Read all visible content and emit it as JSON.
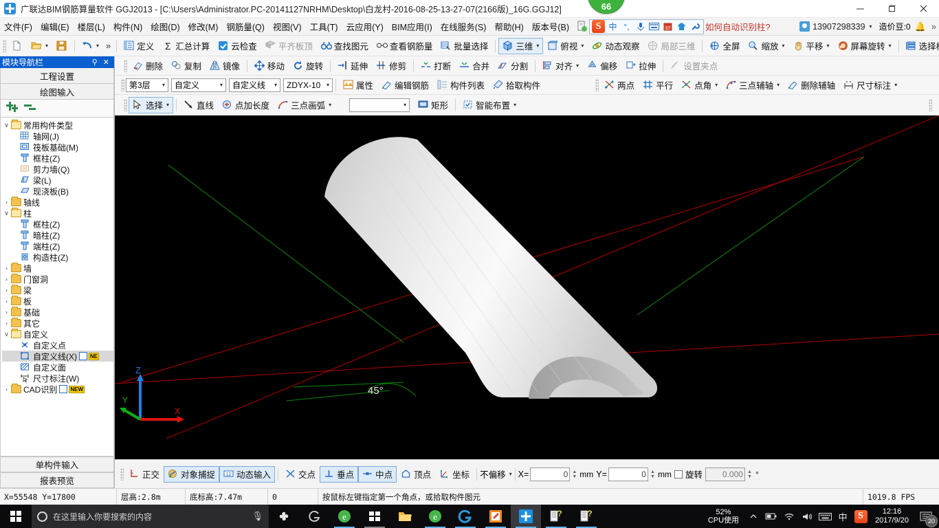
{
  "window": {
    "title": "广联达BIM钢筋算量软件 GGJ2013 - [C:\\Users\\Administrator.PC-20141127NRHM\\Desktop\\白龙村-2016-08-25-13-27-07(2166版)_16G.GGJ12]",
    "badge_value": "66",
    "minimize": "–",
    "maximize": "❐",
    "close": "✕"
  },
  "menubar": {
    "items": [
      {
        "label": "文件(F)"
      },
      {
        "label": "编辑(E)"
      },
      {
        "label": "楼层(L)"
      },
      {
        "label": "构件(N)"
      },
      {
        "label": "绘图(D)"
      },
      {
        "label": "修改(M)"
      },
      {
        "label": "钢筋量(Q)"
      },
      {
        "label": "视图(V)"
      },
      {
        "label": "工具(T)"
      },
      {
        "label": "云应用(Y)"
      },
      {
        "label": "BIM应用(I)"
      },
      {
        "label": "在线服务(S)"
      },
      {
        "label": "帮助(H)"
      },
      {
        "label": "版本号(B)"
      }
    ],
    "ime": {
      "lang": "中",
      "sogou": "S"
    },
    "promo_link": "如何自动识别柱?",
    "account_phone": "13907298339",
    "coins_label": "造价豆:0",
    "overflow": "»"
  },
  "toolbar_row1": {
    "items": [
      {
        "name": "new",
        "label": "",
        "icon": "page-icon"
      },
      {
        "name": "open",
        "label": "",
        "icon": "folder-open-icon",
        "caret": true
      },
      {
        "name": "save",
        "label": "",
        "icon": "save-icon"
      },
      {
        "name": "undo",
        "label": "",
        "icon": "undo-icon",
        "caret": true
      }
    ],
    "overflow": "»",
    "group2": [
      {
        "name": "define",
        "label": "定义",
        "icon": "define-icon",
        "dim": false
      },
      {
        "name": "summary-calc",
        "label": "汇总计算",
        "icon": "sigma-icon",
        "dim": false
      },
      {
        "name": "cloud-check",
        "label": "云检查",
        "icon": "cloud-check-icon",
        "dim": false
      },
      {
        "name": "align-slab-top",
        "label": "平齐板顶",
        "icon": "align-slab-icon",
        "dim": true
      },
      {
        "name": "find-element",
        "label": "查找图元",
        "icon": "binoculars-icon",
        "dim": false
      },
      {
        "name": "view-rebar-qty",
        "label": "查看钢筋量",
        "icon": "glasses-icon",
        "dim": false
      },
      {
        "name": "batch-select",
        "label": "批量选择",
        "icon": "batch-select-icon",
        "dim": false
      }
    ],
    "group3": [
      {
        "name": "three-d",
        "label": "三维",
        "icon": "cube-icon",
        "caret": true,
        "active": true
      },
      {
        "name": "top-view",
        "label": "俯视",
        "icon": "topview-icon",
        "caret": true
      },
      {
        "name": "dynamic-observe",
        "label": "动态观察",
        "icon": "orbit-icon"
      },
      {
        "name": "local-three-d",
        "label": "局部三维",
        "icon": "local3d-icon",
        "dim": true
      },
      {
        "name": "fullscreen",
        "label": "全屏",
        "icon": "fullscreen-icon"
      },
      {
        "name": "zoom",
        "label": "缩放",
        "icon": "zoom-icon",
        "caret": true
      },
      {
        "name": "pan",
        "label": "平移",
        "icon": "pan-icon",
        "caret": true
      },
      {
        "name": "screen-rotate",
        "label": "屏幕旋转",
        "icon": "screen-rotate-icon",
        "caret": true
      },
      {
        "name": "select-floor",
        "label": "选择楼层",
        "icon": "floor-icon"
      }
    ],
    "overflow2": "»"
  },
  "toolbar_row2": {
    "items": [
      {
        "name": "delete",
        "label": "删除",
        "icon": "eraser-icon"
      },
      {
        "name": "copy",
        "label": "复制",
        "icon": "copy-icon"
      },
      {
        "name": "mirror",
        "label": "镜像",
        "icon": "mirror-icon"
      },
      {
        "name": "move",
        "label": "移动",
        "icon": "move-icon"
      },
      {
        "name": "rotate",
        "label": "旋转",
        "icon": "rotate-icon"
      },
      {
        "name": "extend",
        "label": "延伸",
        "icon": "extend-icon"
      },
      {
        "name": "trim",
        "label": "修剪",
        "icon": "trim-icon"
      },
      {
        "name": "break",
        "label": "打断",
        "icon": "break-icon"
      },
      {
        "name": "merge",
        "label": "合并",
        "icon": "merge-icon"
      },
      {
        "name": "split",
        "label": "分割",
        "icon": "split-icon"
      },
      {
        "name": "align",
        "label": "对齐",
        "icon": "align-icon",
        "caret": true
      },
      {
        "name": "offset",
        "label": "偏移",
        "icon": "offset-icon"
      },
      {
        "name": "stretch",
        "label": "拉伸",
        "icon": "stretch-icon"
      },
      {
        "name": "set-grip",
        "label": "设置夹点",
        "icon": "grip-icon",
        "dim": true
      }
    ]
  },
  "toolbar_row3": {
    "selects": [
      {
        "name": "floor-select",
        "value": "第3层"
      },
      {
        "name": "component-type-select",
        "value": "自定义"
      },
      {
        "name": "component-subtype-select",
        "value": "自定义线"
      },
      {
        "name": "component-name-select",
        "value": "ZDYX-10"
      }
    ],
    "buttons": [
      {
        "name": "properties",
        "label": "属性",
        "icon": "properties-icon"
      },
      {
        "name": "edit-rebar",
        "label": "编辑钢筋",
        "icon": "edit-rebar-icon"
      },
      {
        "name": "component-list",
        "label": "构件列表",
        "icon": "list-icon"
      },
      {
        "name": "pick-component",
        "label": "拾取构件",
        "icon": "pipette-icon"
      }
    ],
    "aux_axis": [
      {
        "name": "two-point",
        "label": "两点",
        "icon": "two-point-icon"
      },
      {
        "name": "parallel",
        "label": "平行",
        "icon": "parallel-icon"
      },
      {
        "name": "point-angle",
        "label": "点角",
        "icon": "point-angle-icon",
        "caret": true
      },
      {
        "name": "three-point-aux-axis",
        "label": "三点辅轴",
        "icon": "three-point-axis-icon",
        "caret": true
      },
      {
        "name": "delete-aux-axis",
        "label": "删除辅轴",
        "icon": "delete-axis-icon"
      },
      {
        "name": "dimension",
        "label": "尺寸标注",
        "icon": "dimension-icon",
        "caret": true
      }
    ]
  },
  "toolbar_row4": {
    "items": [
      {
        "name": "select-tool",
        "label": "选择",
        "icon": "cursor-icon",
        "caret": true,
        "active": true
      },
      {
        "name": "line-tool",
        "label": "直线",
        "icon": "line-icon"
      },
      {
        "name": "point-plus-length",
        "label": "点加长度",
        "icon": "point-length-icon"
      },
      {
        "name": "three-point-arc",
        "label": "三点画弧",
        "icon": "arc-icon",
        "caret": true
      },
      {
        "name": "empty-combo",
        "label": "",
        "icon": "",
        "caret": true
      },
      {
        "name": "rectangle",
        "label": "矩形",
        "icon": "rect-icon"
      },
      {
        "name": "smart-layout",
        "label": "智能布置",
        "icon": "smart-layout-icon",
        "caret": true
      }
    ]
  },
  "sidebar": {
    "header": {
      "title": "模块导航栏",
      "pin": "📌",
      "close": "✕"
    },
    "top_buttons": [
      {
        "name": "project-settings",
        "label": "工程设置"
      },
      {
        "name": "drawing-input",
        "label": "绘图输入"
      }
    ],
    "tree": [
      {
        "label": "常用构件类型",
        "level": 0,
        "type": "folder",
        "expanded": true
      },
      {
        "label": "轴网(J)",
        "level": 1,
        "type": "leaf",
        "icon": "grid-icon"
      },
      {
        "label": "筏板基础(M)",
        "level": 1,
        "type": "leaf",
        "icon": "raft-icon"
      },
      {
        "label": "框柱(Z)",
        "level": 1,
        "type": "leaf",
        "icon": "column-icon"
      },
      {
        "label": "剪力墙(Q)",
        "level": 1,
        "type": "leaf",
        "icon": "shearwall-icon"
      },
      {
        "label": "梁(L)",
        "level": 1,
        "type": "leaf",
        "icon": "beam-icon"
      },
      {
        "label": "现浇板(B)",
        "level": 1,
        "type": "leaf",
        "icon": "slab-icon"
      },
      {
        "label": "轴线",
        "level": 0,
        "type": "folder",
        "expanded": false
      },
      {
        "label": "柱",
        "level": 0,
        "type": "folder",
        "expanded": true
      },
      {
        "label": "框柱(Z)",
        "level": 1,
        "type": "leaf",
        "icon": "column-icon"
      },
      {
        "label": "暗柱(Z)",
        "level": 1,
        "type": "leaf",
        "icon": "column-icon"
      },
      {
        "label": "端柱(Z)",
        "level": 1,
        "type": "leaf",
        "icon": "column-icon"
      },
      {
        "label": "构造柱(Z)",
        "level": 1,
        "type": "leaf",
        "icon": "constr-column-icon"
      },
      {
        "label": "墙",
        "level": 0,
        "type": "folder",
        "expanded": false
      },
      {
        "label": "门窗洞",
        "level": 0,
        "type": "folder",
        "expanded": false
      },
      {
        "label": "梁",
        "level": 0,
        "type": "folder",
        "expanded": false
      },
      {
        "label": "板",
        "level": 0,
        "type": "folder",
        "expanded": false
      },
      {
        "label": "基础",
        "level": 0,
        "type": "folder",
        "expanded": false
      },
      {
        "label": "其它",
        "level": 0,
        "type": "folder",
        "expanded": false
      },
      {
        "label": "自定义",
        "level": 0,
        "type": "folder",
        "expanded": true
      },
      {
        "label": "自定义点",
        "level": 1,
        "type": "leaf",
        "icon": "custom-point-icon"
      },
      {
        "label": "自定义线(X)",
        "level": 1,
        "type": "leaf",
        "icon": "custom-line-icon",
        "selected": true,
        "badge": "NE",
        "grid": true
      },
      {
        "label": "自定义面",
        "level": 1,
        "type": "leaf",
        "icon": "custom-face-icon"
      },
      {
        "label": "尺寸标注(W)",
        "level": 1,
        "type": "leaf",
        "icon": "dimension-icon"
      },
      {
        "label": "CAD识别",
        "level": 0,
        "type": "folder",
        "expanded": false,
        "badge": "NEW",
        "grid": true
      }
    ],
    "bottom_buttons": [
      {
        "name": "single-component-input",
        "label": "单构件输入"
      },
      {
        "name": "report-preview",
        "label": "报表预览"
      }
    ]
  },
  "viewport": {
    "angle_label": "45°",
    "axis": {
      "x": "X",
      "y": "Y",
      "z": "Z"
    },
    "bg_color": "#000000",
    "model_color": "#e9e9e9",
    "axis_line_red": "#b40000",
    "axis_line_green": "#00a000"
  },
  "snapbar": {
    "modes": [
      {
        "name": "ortho",
        "label": "正交",
        "icon": "ortho-icon",
        "on": false
      },
      {
        "name": "object-snap",
        "label": "对象捕捉",
        "icon": "object-snap-icon",
        "on": true
      },
      {
        "name": "dynamic-input",
        "label": "动态输入",
        "icon": "dynamic-input-icon",
        "on": true
      }
    ],
    "snaps": [
      {
        "name": "intersection",
        "label": "交点",
        "icon": "intersection-icon",
        "on": false
      },
      {
        "name": "perpendicular",
        "label": "垂点",
        "icon": "perpendicular-icon",
        "on": true
      },
      {
        "name": "midpoint",
        "label": "中点",
        "icon": "midpoint-icon",
        "on": true
      },
      {
        "name": "vertex",
        "label": "顶点",
        "icon": "vertex-icon",
        "on": false
      },
      {
        "name": "coordinate",
        "label": "坐标",
        "icon": "coordinate-icon",
        "on": false
      }
    ],
    "offset_mode": "不偏移",
    "x_label": "X=",
    "x_value": "0",
    "x_unit": "mm",
    "y_label": "Y=",
    "y_value": "0",
    "y_unit": "mm",
    "rotate_label": "旋转",
    "rotate_value": "0.000",
    "rotate_unit": "°"
  },
  "statusbar": {
    "coords": "X=55548  Y=17800",
    "floor_height": "层高:2.8m",
    "base_elevation": "底标高:7.47m",
    "extra": "0",
    "hint": "按鼠标左键指定第一个角点，或拾取构件图元",
    "fps": "1019.8 FPS"
  },
  "taskbar": {
    "search_placeholder": "在这里输入你要搜索的内容",
    "apps": [
      {
        "name": "taskbar-app-sogou-pinwheel",
        "glyph": "✿",
        "color": "#e8e8e8"
      },
      {
        "name": "taskbar-app-browser-g",
        "glyph": "◌",
        "color": "#d8d8d8"
      },
      {
        "name": "taskbar-app-ie-like",
        "glyph": "e",
        "color": "#46b64a"
      },
      {
        "name": "taskbar-app-store",
        "glyph": "▦",
        "color": "#3a8fd0"
      },
      {
        "name": "taskbar-app-explorer",
        "glyph": "📁",
        "color": "#f0b93c"
      },
      {
        "name": "taskbar-app-green-e",
        "glyph": "e",
        "color": "#46b64a"
      },
      {
        "name": "taskbar-app-maxthon",
        "glyph": "◌",
        "color": "#2a9bdf"
      },
      {
        "name": "taskbar-app-notes",
        "glyph": "📝",
        "color": "#f08a24"
      },
      {
        "name": "taskbar-app-ggj",
        "glyph": "✛",
        "color": "#1b8fe0"
      },
      {
        "name": "taskbar-app-unknown-1",
        "glyph": "?",
        "color": "#e8d44a"
      },
      {
        "name": "taskbar-app-unknown-2",
        "glyph": "?",
        "color": "#e8d44a"
      }
    ],
    "cpu_percent": "52%",
    "cpu_label": "CPU使用",
    "tray_icons": [
      "∧",
      "🔋",
      "📶",
      "🔊",
      "⌨",
      "中"
    ],
    "ime_s": "S",
    "time": "12:16",
    "date": "2017/9/20",
    "action_center_badge": "20"
  }
}
